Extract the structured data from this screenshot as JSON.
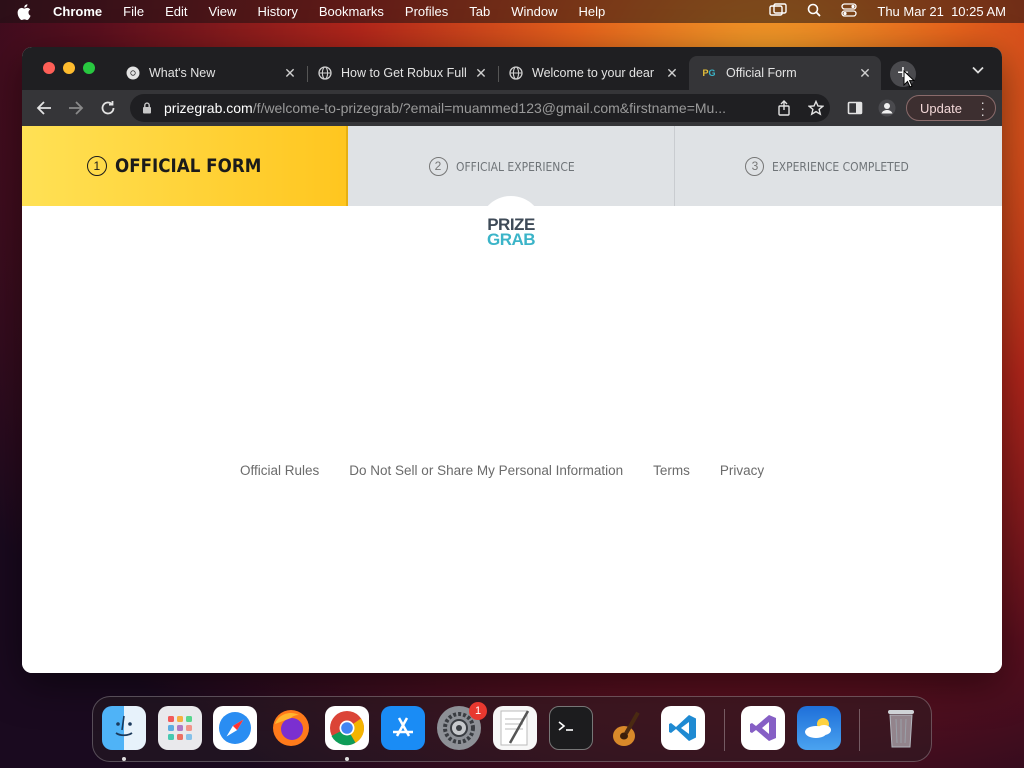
{
  "menubar": {
    "app_name": "Chrome",
    "menus": [
      "File",
      "Edit",
      "View",
      "History",
      "Bookmarks",
      "Profiles",
      "Tab",
      "Window",
      "Help"
    ],
    "datetime": "Thu Mar 21  10:25 AM"
  },
  "browser": {
    "tabs": [
      {
        "title": "What's New",
        "icon": "chrome-icon"
      },
      {
        "title": "How to Get Robux Full",
        "icon": "globe-icon"
      },
      {
        "title": "Welcome to your dear",
        "icon": "globe-icon"
      },
      {
        "title": "Official Form",
        "icon": "prizegrab-favicon",
        "active": true
      }
    ],
    "url_host": "prizegrab.com",
    "url_rest": "/f/welcome-to-prizegrab/?email=muammed123@gmail.com&firstname=Mu...",
    "update_label": "Update"
  },
  "page": {
    "steps": [
      {
        "num": "1",
        "label": "OFFICIAL FORM"
      },
      {
        "num": "2",
        "label": "OFFICIAL EXPERIENCE"
      },
      {
        "num": "3",
        "label": "EXPERIENCE COMPLETED"
      }
    ],
    "logo": {
      "line1": "PRIZE",
      "line2": "GRAB"
    },
    "footer_links": [
      "Official Rules",
      "Do Not Sell or Share My Personal Information",
      "Terms",
      "Privacy"
    ]
  },
  "dock": {
    "apps": [
      "finder-icon",
      "launchpad-icon",
      "safari-icon",
      "firefox-icon",
      "chrome-icon",
      "app-store-icon",
      "system-settings-icon",
      "textedit-icon",
      "terminal-icon",
      "garageband-icon",
      "vscode-icon",
      "visual-studio-icon",
      "weather-icon",
      "trash-icon"
    ],
    "settings_badge": "1"
  }
}
